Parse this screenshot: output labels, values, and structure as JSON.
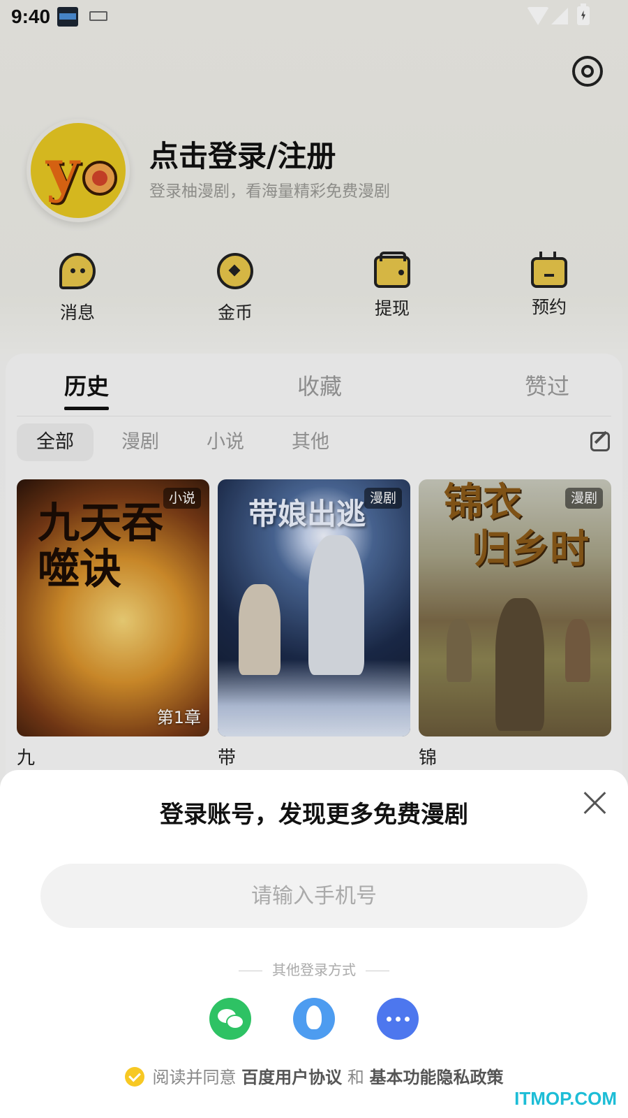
{
  "status_bar": {
    "time": "9:40"
  },
  "profile": {
    "title": "点击登录/注册",
    "subtitle": "登录柚漫剧，看海量精彩免费漫剧"
  },
  "quick_actions": [
    {
      "label": "消息",
      "icon": "message-icon"
    },
    {
      "label": "金币",
      "icon": "coin-icon"
    },
    {
      "label": "提现",
      "icon": "wallet-icon"
    },
    {
      "label": "预约",
      "icon": "calendar-icon"
    }
  ],
  "tabs": [
    {
      "label": "历史",
      "active": true
    },
    {
      "label": "收藏",
      "active": false
    },
    {
      "label": "赞过",
      "active": false
    }
  ],
  "filters": [
    {
      "label": "全部",
      "active": true
    },
    {
      "label": "漫剧",
      "active": false
    },
    {
      "label": "小说",
      "active": false
    },
    {
      "label": "其他",
      "active": false
    }
  ],
  "items": [
    {
      "title": "九天吞噬诀",
      "badge": "小说",
      "chapter": "第1章"
    },
    {
      "title": "带娘出逃",
      "badge": "漫剧"
    },
    {
      "title": "锦衣归乡时",
      "badge": "漫剧"
    }
  ],
  "cover_art": {
    "c1": "九天吞噬诀",
    "c2": "带娘出逃",
    "c3_line1": "锦衣",
    "c3_line2": "归乡时"
  },
  "login_sheet": {
    "title": "登录账号，发现更多免费漫剧",
    "phone_placeholder": "请输入手机号",
    "other_methods_label": "其他登录方式",
    "agree_prefix": "阅读并同意",
    "agree_link1": "百度用户协议",
    "agree_and": "和",
    "agree_link2": "基本功能隐私政策"
  },
  "watermark": "ITMOP.COM",
  "colors": {
    "accent": "#f7c823",
    "wechat": "#2ec264",
    "qq": "#4d9cf0",
    "more": "#4d77ee"
  }
}
